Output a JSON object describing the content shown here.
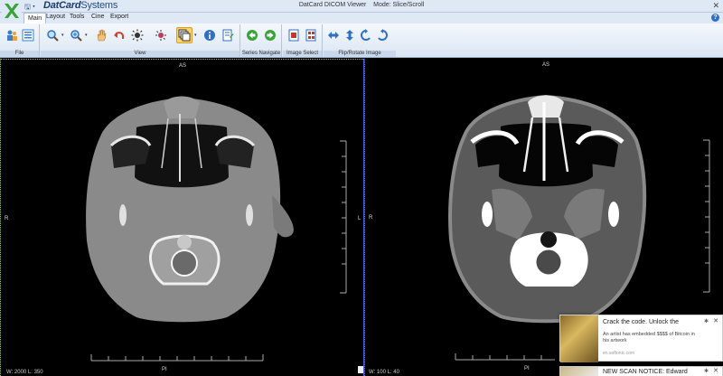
{
  "titlebar": {
    "brand_bold": "DatCard",
    "brand_light": "Systems",
    "window_title": "DatCard DICOM Viewer",
    "mode_text": "Mode: Slice/Scroll",
    "close_glyph": "✕"
  },
  "tabs": [
    {
      "label": "Main"
    },
    {
      "label": "Layout"
    },
    {
      "label": "Tools"
    },
    {
      "label": "Cine"
    },
    {
      "label": "Export"
    }
  ],
  "help_glyph": "?",
  "ribbon": {
    "groups": [
      {
        "label": "File"
      },
      {
        "label": "View"
      },
      {
        "label": "Series Navigate"
      },
      {
        "label": "Image Select"
      },
      {
        "label": "Flip/Rotate Image"
      }
    ]
  },
  "viewport_left": {
    "top": "AS",
    "left": "R",
    "right": "L",
    "bottom": "PI",
    "wl": "W: 2000 L: 350"
  },
  "viewport_right": {
    "top": "AS",
    "left": "R",
    "bottom": "PI",
    "wl": "W: 100 L: 40"
  },
  "ad": {
    "title": "Crack the code. Unlock the",
    "body": "An artist has embedded $$$$ of Bitcoin in his artwork",
    "source": "en.softonic.com",
    "gear_glyph": "✱",
    "close_glyph": "✕"
  },
  "ad2": {
    "title": "NEW SCAN NOTICE: Edward",
    "gear_glyph": "✱",
    "close_glyph": "✕"
  },
  "colors": {
    "accent": "#2f6fc4",
    "selected": "#ffd666",
    "left_border": "#9bd36b",
    "right_border": "#4a7dff"
  }
}
